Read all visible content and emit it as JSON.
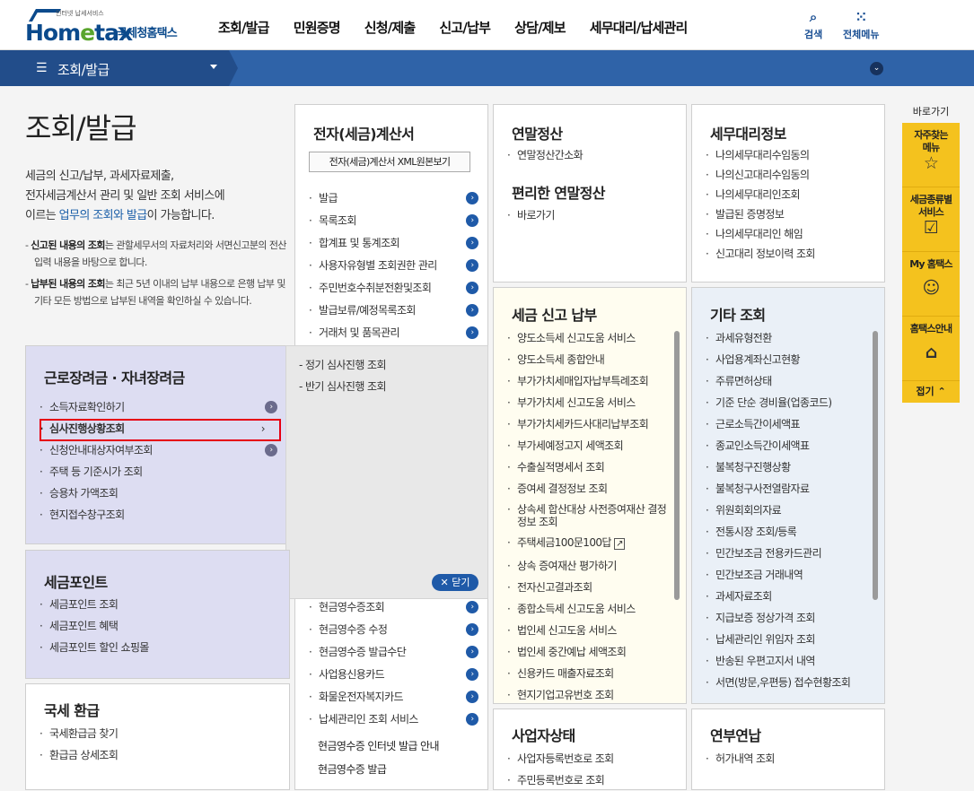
{
  "header": {
    "logo_word_a": "Hom",
    "logo_word_e": "e",
    "logo_word_b": "tax",
    "logo_tagline": "인터넷 납세서비스",
    "logo_kr": "국세청홈택스",
    "nav": [
      "조회/발급",
      "민원증명",
      "신청/제출",
      "신고/납부",
      "상담/제보",
      "세무대리/납세관리"
    ],
    "search": "검색",
    "all_menu": "전체메뉴",
    "search_icon": "search-icon",
    "grid_icon": "grid-icon"
  },
  "subbar": {
    "title": "조회/발급"
  },
  "intro": {
    "title": "조회/발급",
    "desc_1": "세금의 신고/납부, 과세자료제출,",
    "desc_2": "전자세금계산서 관리 및 일반 조회 서비스에",
    "desc_3a": "이르는 ",
    "desc_3b": "업무의 조회와 발급",
    "desc_3c": "이 가능합니다.",
    "note1_bold": "신고된 내용의 조회",
    "note1_text": "는 관할세무서의 자료처리와 서면신고분의 전산 입력 내용을 바탕으로 합니다.",
    "note2_bold": "납부된 내용의 조회",
    "note2_text": "는 최근 5년 이내의 납부 내용으로 은행 납부 및 기타 모든 방법으로 납부된 내역을 확인하실 수 있습니다."
  },
  "ebill": {
    "title": "전자(세금)계산서",
    "xml_btn": "전자(세금)계산서 XML원본보기",
    "items": [
      "발급",
      "목록조회",
      "합계표 및 통계조회",
      "사용자유형별 조회권한 관리",
      "주민번호수취분전환및조회",
      "발급보류/예정목록조회",
      "거래처 및 품목관리"
    ],
    "cash_items": [
      "현금영수증조회",
      "현금영수증 수정",
      "현금영수증 발급수단",
      "사업용신용카드",
      "화물운전자복지카드",
      "납세관리인 조회 서비스"
    ],
    "cash_plain": [
      "현금영수증 인터넷 발급 안내",
      "현금영수증 발급"
    ]
  },
  "yearend": {
    "title": "연말정산",
    "items": [
      "연말정산간소화"
    ],
    "title2": "편리한 연말정산",
    "items2": [
      "바로가기"
    ]
  },
  "agent": {
    "title": "세무대리정보",
    "items": [
      "나의세무대리수임동의",
      "나의신고대리수임동의",
      "나의세무대리인조회",
      "발급된 증명정보",
      "나의세무대리인 해임",
      "신고대리 정보이력 조회"
    ]
  },
  "labor": {
    "title": "근로장려금 · 자녀장려금",
    "items": [
      "소득자료확인하기",
      "심사진행상황조회",
      "신청안내대상자여부조회",
      "주택 등 기준시가 조회",
      "승용차 가액조회",
      "현지접수창구조회"
    ]
  },
  "popup": {
    "items": [
      "정기 심사진행 조회",
      "반기 심사진행 조회"
    ],
    "close": "닫기"
  },
  "taxpoint": {
    "title": "세금포인트",
    "items": [
      "세금포인트 조회",
      "세금포인트 혜택",
      "세금포인트 할인 쇼핑몰"
    ]
  },
  "refund": {
    "title": "국세 환급",
    "items": [
      "국세환급금 찾기",
      "환급금 상세조회"
    ]
  },
  "filing": {
    "title": "세금 신고 납부",
    "items": [
      "양도소득세 신고도움 서비스",
      "양도소득세 종합안내",
      "부가가치세매입자납부특례조회",
      "부가가치세 신고도움 서비스",
      "부가가치세카드사대리납부조회",
      "부가세예정고지 세액조회",
      "수출실적명세서 조회",
      "증여세 결정정보 조회",
      "상속세 합산대상 사전증여재산 결정정보 조회",
      "주택세금100문100답",
      "상속 증여재산 평가하기",
      "전자신고결과조회",
      "종합소득세 신고도움 서비스",
      "법인세 신고도움 서비스",
      "법인세 중간예납 세액조회",
      "신용카드 매출자료조회",
      "현지기업고유번호 조회"
    ]
  },
  "etc": {
    "title": "기타 조회",
    "items": [
      "과세유형전환",
      "사업용계좌신고현황",
      "주류면허상태",
      "기준 단순 경비율(업종코드)",
      "근로소득간이세액표",
      "종교인소득간이세액표",
      "불복청구진행상황",
      "불복청구사전열람자료",
      "위원회회의자료",
      "전통시장 조회/등록",
      "민간보조금 전용카드관리",
      "민간보조금 거래내역",
      "과세자료조회",
      "지급보증 정상가격 조회",
      "납세관리인 위임자 조회",
      "반송된 우편고지서 내역",
      "서면(방문,우편등) 접수현황조회"
    ]
  },
  "biz": {
    "title": "사업자상태",
    "items": [
      "사업자등록번호로 조회",
      "주민등록번호로 조회"
    ]
  },
  "annual": {
    "title": "연부연납",
    "items": [
      "허가내역 조회"
    ]
  },
  "quick": {
    "title": "바로가기",
    "items": [
      {
        "l1": "자주찾는",
        "l2": "메뉴",
        "icon": "☆"
      },
      {
        "l1": "세금종류별",
        "l2": "서비스",
        "icon": "☑"
      },
      {
        "l1": "My 홈택스",
        "l2": "",
        "icon": "☺"
      },
      {
        "l1": "홈택스안내",
        "l2": "",
        "icon": "⌂"
      }
    ],
    "fold": "접기"
  }
}
